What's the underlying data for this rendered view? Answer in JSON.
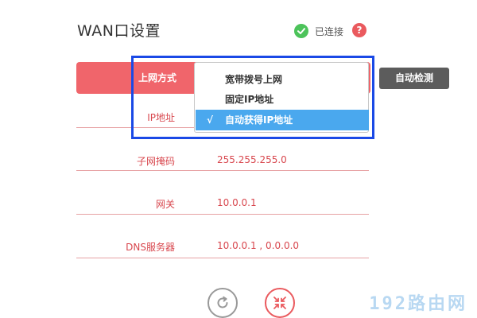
{
  "header": {
    "title": "WAN口设置",
    "status_text": "已连接",
    "help_glyph": "?"
  },
  "connection": {
    "label": "上网方式",
    "autodetect_label": "自动检测"
  },
  "dropdown": {
    "options": [
      {
        "label": "宽带拨号上网",
        "selected": false
      },
      {
        "label": "固定IP地址",
        "selected": false
      },
      {
        "label": "自动获得IP地址",
        "selected": true
      }
    ],
    "check_glyph": "√"
  },
  "fields": {
    "ip": {
      "label": "IP地址",
      "value": ""
    },
    "mask": {
      "label": "子网掩码",
      "value": "255.255.255.0"
    },
    "gateway": {
      "label": "网关",
      "value": "10.0.0.1"
    },
    "dns": {
      "label": "DNS服务器",
      "value": "10.0.0.1 , 0.0.0.0"
    }
  },
  "watermark": "192路由网",
  "colors": {
    "accent": "#f0656b",
    "text_red": "#d8474e",
    "connected_green": "#4cc35a",
    "selected_blue": "#4aa8ee",
    "highlight_blue": "#1a49e6",
    "button_dark": "#5c5c5c"
  },
  "icons": {
    "status": "check-circle-icon",
    "help": "question-circle-icon",
    "refresh": "refresh-icon",
    "cancel": "collapse-arrows-icon"
  }
}
